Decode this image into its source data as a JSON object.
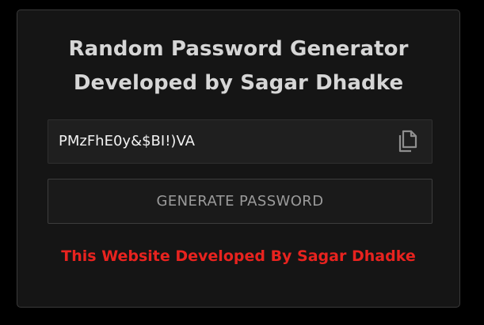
{
  "header": {
    "title_line1": "Random Password Generator",
    "title_line2": "Developed by Sagar Dhadke"
  },
  "password": {
    "value": "PMzFhE0y&$BI!)VA",
    "copy_icon": "copy-icon"
  },
  "generate_button": {
    "label": "GENERATE PASSWORD"
  },
  "footer": {
    "text": "This Website Developed By Sagar Dhadke",
    "color": "#e8231f"
  },
  "colors": {
    "background": "#000000",
    "card": "#151515",
    "title": "#d6d6d6",
    "button_text": "#9b9b9b"
  }
}
